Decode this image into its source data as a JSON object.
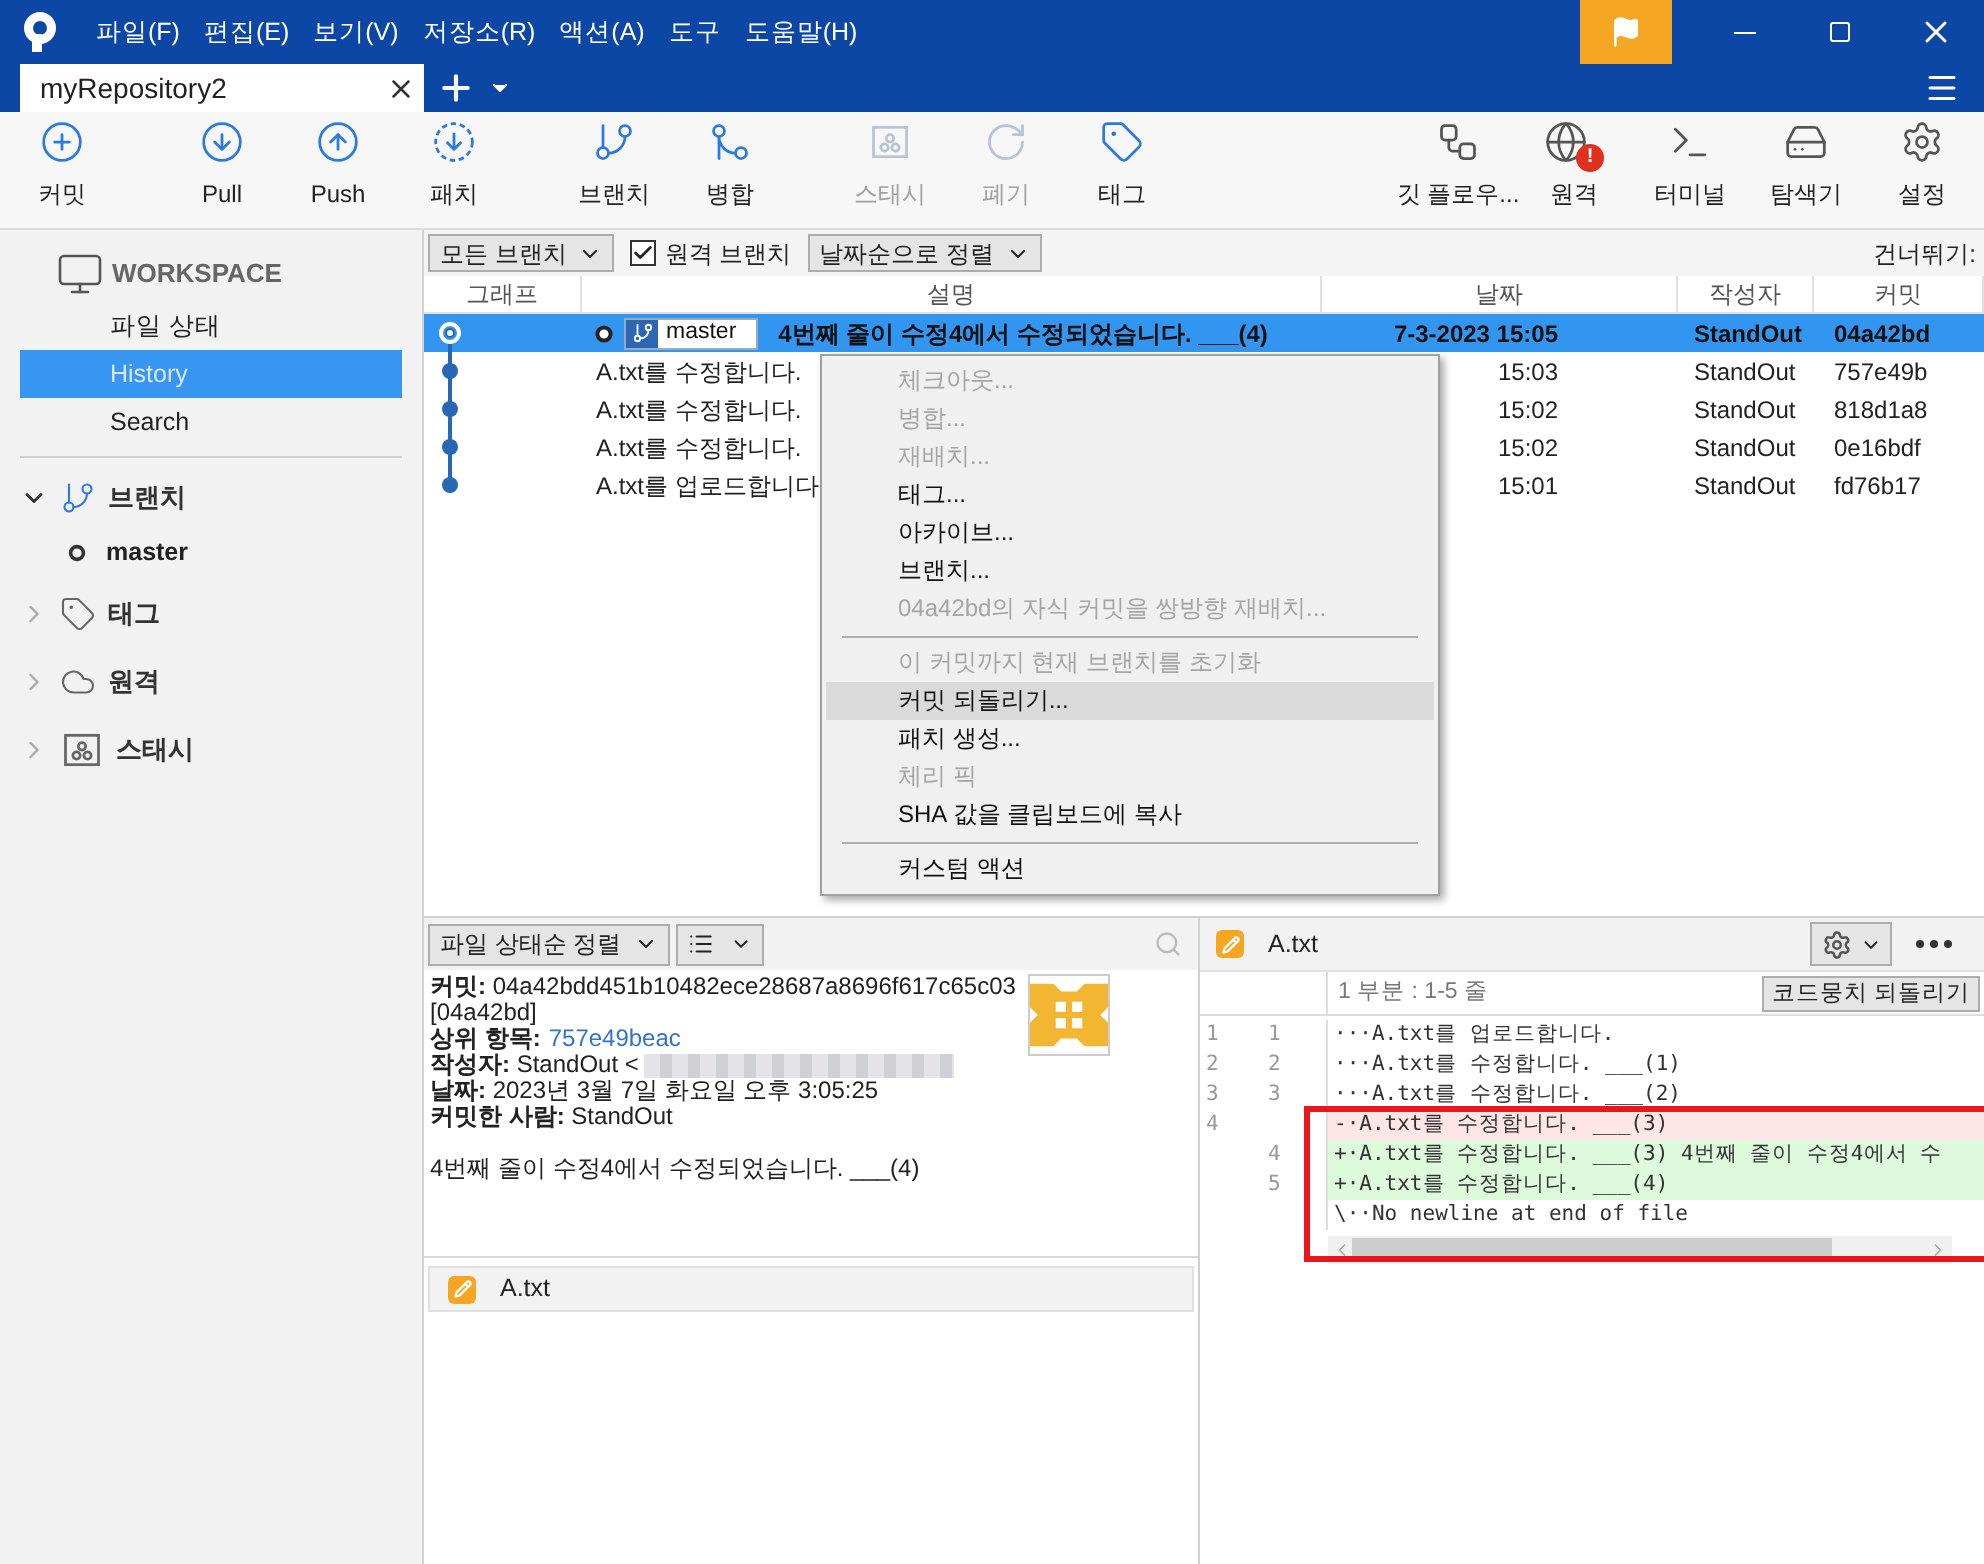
{
  "window": {
    "menu": [
      "파일(F)",
      "편집(E)",
      "보기(V)",
      "저장소(R)",
      "액션(A)",
      "도구",
      "도움말(H)"
    ]
  },
  "tabs": [
    {
      "label": "myRepository2",
      "selected": true
    }
  ],
  "toolbar": {
    "left": [
      {
        "kind": "commit",
        "label": "커밋",
        "disabled": false
      },
      {
        "kind": "pull",
        "label": "Pull",
        "disabled": false
      },
      {
        "kind": "push",
        "label": "Push",
        "disabled": false
      },
      {
        "kind": "fetch",
        "label": "패치",
        "disabled": false
      },
      {
        "kind": "branch",
        "label": "브랜치",
        "disabled": false
      },
      {
        "kind": "merge",
        "label": "병합",
        "disabled": false
      },
      {
        "kind": "stash",
        "label": "스태시",
        "disabled": true
      },
      {
        "kind": "discard",
        "label": "폐기",
        "disabled": true
      },
      {
        "kind": "tag",
        "label": "태그",
        "disabled": false
      }
    ],
    "right": [
      {
        "kind": "flow",
        "label": "깃 플로우...",
        "disabled": false
      },
      {
        "kind": "remote",
        "label": "원격",
        "disabled": false,
        "badge": "!"
      },
      {
        "kind": "terminal",
        "label": "터미널",
        "disabled": false
      },
      {
        "kind": "explorer",
        "label": "탐색기",
        "disabled": false
      },
      {
        "kind": "settings",
        "label": "설정",
        "disabled": false
      }
    ]
  },
  "sidebar": {
    "workspace": "WORKSPACE",
    "items": [
      {
        "label": "파일 상태",
        "selected": false
      },
      {
        "label": "History",
        "selected": true
      },
      {
        "label": "Search",
        "selected": false
      }
    ],
    "sections": [
      {
        "kind": "branch",
        "label": "브랜치",
        "expanded": true,
        "children": [
          {
            "label": "master"
          }
        ]
      },
      {
        "kind": "tag",
        "label": "태그",
        "expanded": false
      },
      {
        "kind": "remote",
        "label": "원격",
        "expanded": false
      },
      {
        "kind": "stash",
        "label": "스태시",
        "expanded": false
      }
    ]
  },
  "filter": {
    "branches": "모든 브랜치",
    "remote": {
      "label": "원격 브랜치",
      "checked": true
    },
    "sort": "날짜순으로 정렬",
    "skip": "건너뛰기:"
  },
  "table": {
    "columns": [
      "그래프",
      "설명",
      "날짜",
      "작성자",
      "커밋"
    ],
    "rows": [
      {
        "selected": true,
        "branch": "master",
        "description": "4번째 줄이 수정4에서 수정되었습니다. ___(4)",
        "date": "7-3-2023 15:05",
        "author": "StandOut",
        "commit": "04a42bd"
      },
      {
        "selected": false,
        "description": "A.txt를 수정합니다.",
        "date": "15:03",
        "author": "StandOut",
        "commit": "757e49b"
      },
      {
        "selected": false,
        "description": "A.txt를 수정합니다.",
        "date": "15:02",
        "author": "StandOut",
        "commit": "818d1a8"
      },
      {
        "selected": false,
        "description": "A.txt를 수정합니다.",
        "date": "15:02",
        "author": "StandOut",
        "commit": "0e16bdf"
      },
      {
        "selected": false,
        "description": "A.txt를 업로드합니다",
        "date": "15:01",
        "author": "StandOut",
        "commit": "fd76b17"
      }
    ]
  },
  "context_menu": [
    {
      "kind": "item",
      "label": "체크아웃...",
      "disabled": true,
      "highlighted": false
    },
    {
      "kind": "item",
      "label": "병합...",
      "disabled": true,
      "highlighted": false
    },
    {
      "kind": "item",
      "label": "재배치...",
      "disabled": true,
      "highlighted": false
    },
    {
      "kind": "item",
      "label": "태그...",
      "disabled": false,
      "highlighted": false
    },
    {
      "kind": "item",
      "label": "아카이브...",
      "disabled": false,
      "highlighted": false
    },
    {
      "kind": "item",
      "label": "브랜치...",
      "disabled": false,
      "highlighted": false
    },
    {
      "kind": "item",
      "label": "04a42bd의 자식 커밋을 쌍방향 재배치...",
      "disabled": true,
      "highlighted": false
    },
    {
      "kind": "separator"
    },
    {
      "kind": "item",
      "label": "이 커밋까지 현재 브랜치를 초기화",
      "disabled": true,
      "highlighted": false
    },
    {
      "kind": "item",
      "label": "커밋 되돌리기...",
      "disabled": false,
      "highlighted": true
    },
    {
      "kind": "item",
      "label": "패치 생성...",
      "disabled": false,
      "highlighted": false
    },
    {
      "kind": "item",
      "label": "체리 픽",
      "disabled": true,
      "highlighted": false
    },
    {
      "kind": "item",
      "label": "SHA 값을 클립보드에 복사",
      "disabled": false,
      "highlighted": false
    },
    {
      "kind": "separator"
    },
    {
      "kind": "item",
      "label": "커스텀 액션",
      "disabled": false,
      "highlighted": false
    }
  ],
  "details": {
    "sort": "파일 상태순 정렬",
    "lines": [
      {
        "kind": "text",
        "text": "**커밋:** 04a42bdd451b10482ece28687a8696f617c65c03"
      },
      {
        "kind": "text",
        "text": "[04a42bd]"
      },
      {
        "kind": "link",
        "label": "상위 항목:",
        "value": "757e49beac"
      },
      {
        "kind": "redacted",
        "text": "**작성자:** StandOut <"
      },
      {
        "kind": "text",
        "text": "**날짜:** 2023년 3월 7일 화요일 오후 3:05:25"
      },
      {
        "kind": "text",
        "text": "**커밋한 사람:** StandOut"
      }
    ],
    "message": "4번째 줄이 수정4에서 수정되었습니다. ___(4)",
    "files": [
      {
        "name": "A.txt"
      }
    ]
  },
  "diff": {
    "file": "A.txt",
    "hunk": "1 부분 : 1-5 줄",
    "revert": "코드뭉치 되돌리기",
    "lines": [
      {
        "kind": "context",
        "old": "1",
        "new": "1",
        "text": "···A.txt를 업로드합니다."
      },
      {
        "kind": "context",
        "old": "2",
        "new": "2",
        "text": "···A.txt를 수정합니다. ___(1)"
      },
      {
        "kind": "context",
        "old": "3",
        "new": "3",
        "text": "···A.txt를 수정합니다. ___(2)"
      },
      {
        "kind": "removed",
        "old": "4",
        "text": "-·A.txt를 수정합니다. ___(3)"
      },
      {
        "kind": "added",
        "new": "4",
        "text": "+·A.txt를 수정합니다. ___(3) 4번째 줄이 수정4에서 수"
      },
      {
        "kind": "added",
        "new": "5",
        "text": "+·A.txt를 수정합니다. ___(4)"
      },
      {
        "kind": "note",
        "text": "\\··No newline at end of file"
      }
    ]
  }
}
